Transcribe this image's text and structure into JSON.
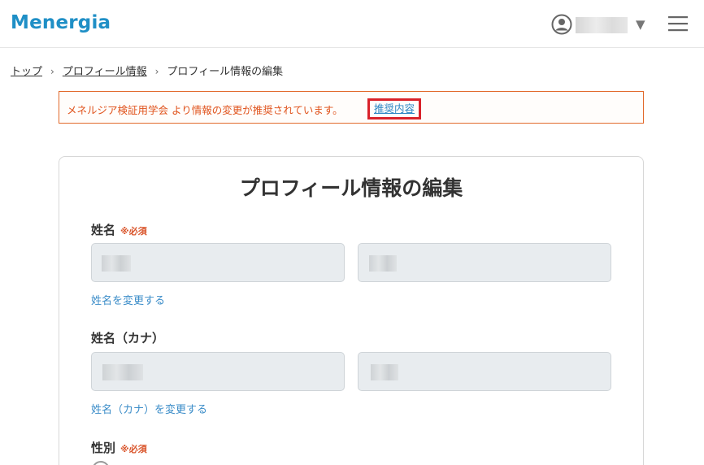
{
  "header": {
    "logo": "Menergia",
    "user_icon": "user-circle-icon",
    "caret": "▼",
    "menu_icon": "hamburger-menu-icon"
  },
  "breadcrumb": {
    "items": [
      "トップ",
      "プロフィール情報",
      "プロフィール情報の編集"
    ]
  },
  "notice": {
    "message": "メネルジア検証用学会 より情報の変更が推奨されています。",
    "link_label": "推奨内容"
  },
  "form": {
    "title": "プロフィール情報の編集",
    "sections": [
      {
        "label": "姓名",
        "required_mark": "※必須",
        "change_link": "姓名を変更する"
      },
      {
        "label": "姓名（カナ）",
        "change_link": "姓名（カナ）を変更する"
      },
      {
        "label": "性別",
        "required_mark": "※必須"
      }
    ]
  },
  "colors": {
    "brand": "#1f8fc6",
    "notice_text": "#e0531c",
    "notice_border": "#e26a2c",
    "highlight": "#d9222a",
    "link": "#3a8cc8",
    "field_bg": "#e8ecef"
  }
}
